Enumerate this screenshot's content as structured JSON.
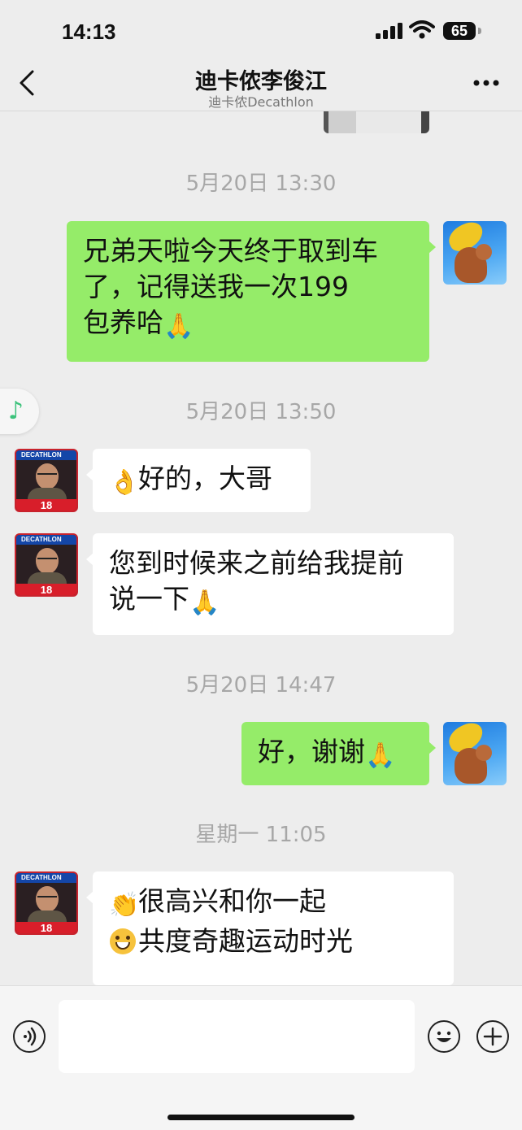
{
  "status_bar": {
    "time": "14:13",
    "battery": "65"
  },
  "header": {
    "title": "迪卡侬李俊江",
    "subtitle": "迪卡侬Decathlon"
  },
  "avatar_badge": {
    "brand": "DECATHLON",
    "number": "18"
  },
  "messages": [
    {
      "timestamp": "5月20日 13:30",
      "sender": "self",
      "lines": [
        "兄弟天啦今天终于取到车",
        "了，记得送我一次199",
        "包养哈"
      ],
      "emoji": "pray"
    },
    {
      "timestamp": "5月20日 13:50",
      "sender": "other",
      "prefix_emoji": "ok",
      "text": "好的，大哥"
    },
    {
      "sender": "other",
      "lines": [
        "您到时候来之前给我提前",
        "说一下"
      ],
      "emoji": "pray"
    },
    {
      "timestamp": "5月20日 14:47",
      "sender": "self",
      "text": "好，谢谢",
      "emoji": "pray"
    },
    {
      "timestamp": "星期一 11:05",
      "sender": "other",
      "lines": [
        "很高兴和你一起",
        "共度奇趣运动时光"
      ],
      "line_emojis": [
        "clap",
        "grin"
      ]
    }
  ],
  "input": {
    "value": "",
    "placeholder": ""
  },
  "colors": {
    "background": "#ededed",
    "self_bubble": "#95ec69",
    "other_bubble": "#ffffff",
    "timestamp_text": "#a7a7a7"
  }
}
